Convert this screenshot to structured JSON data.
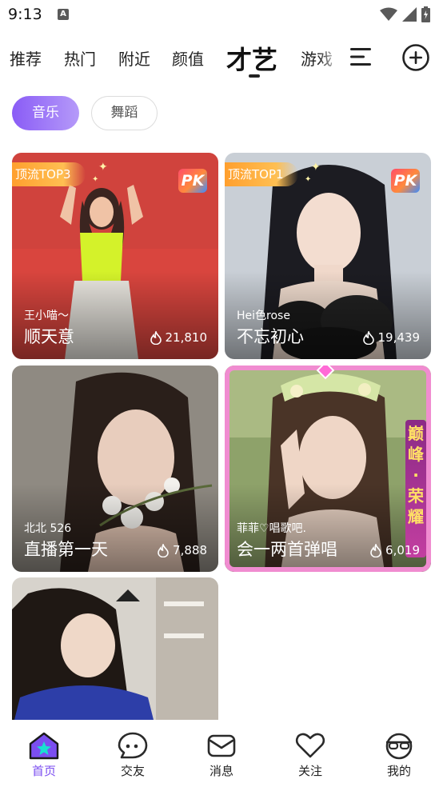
{
  "status_bar": {
    "time": "9:13",
    "notification_badge": "A"
  },
  "top_tabs": {
    "items": [
      "推荐",
      "热门",
      "附近",
      "颜值",
      "才艺",
      "游戏"
    ],
    "active": "才艺"
  },
  "sub_tabs": {
    "items": [
      "音乐",
      "舞蹈"
    ],
    "active": "音乐"
  },
  "cards": [
    {
      "badge": "顶流TOP3",
      "pk": "PK",
      "host": "王小喵～",
      "title": "顺天意",
      "viewers": "21,810"
    },
    {
      "badge": "顶流TOP1",
      "pk": "PK",
      "host": "Hei色rose",
      "title": "不忘初心",
      "viewers": "19,439"
    },
    {
      "host": "北北 526",
      "title": "直播第一天",
      "viewers": "7,888"
    },
    {
      "host": "菲菲♡唱歌吧.",
      "title": "会一两首弹唱",
      "viewers": "6,019",
      "frame_text": "巅峰·荣耀"
    },
    {}
  ],
  "bottom_nav": {
    "items": [
      "首页",
      "交友",
      "消息",
      "关注",
      "我的"
    ],
    "active": "首页"
  },
  "colors": {
    "accent": "#7b4ef0",
    "badge": "#ffa531",
    "frame": "#f08cd0"
  },
  "icons": [
    "battery-icon",
    "wifi-icon",
    "signal-icon",
    "menu-icon",
    "add-icon",
    "flame-icon",
    "home-icon",
    "chat-icon",
    "mail-icon",
    "heart-icon",
    "profile-icon"
  ]
}
